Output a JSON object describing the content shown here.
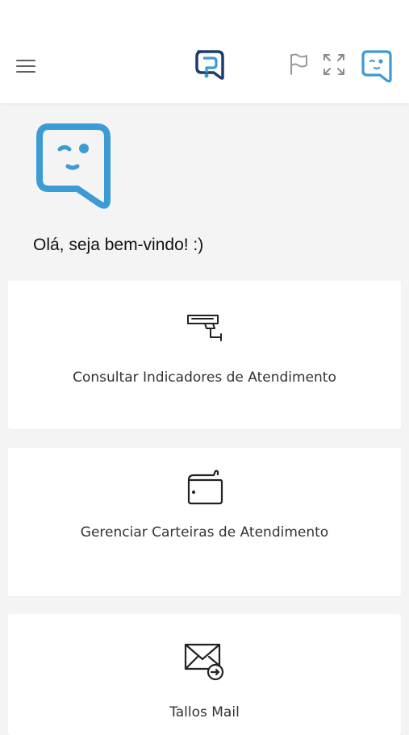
{
  "header": {
    "menu_icon": "hamburger-menu-icon",
    "logo_icon": "app-logo-icon",
    "flag_icon": "flag-icon",
    "expand_icon": "expand-fullscreen-icon",
    "avatar_icon": "assistant-face-icon",
    "accent_color": "#3b9bd4",
    "logo_color": "#1c3d6e"
  },
  "welcome": {
    "avatar_icon": "assistant-face-icon",
    "greeting": "Olá, seja bem-vindo! :)"
  },
  "cards": [
    {
      "icon": "surveillance-camera-icon",
      "label": "Consultar Indicadores de Atendimento"
    },
    {
      "icon": "wallet-icon",
      "label": "Gerenciar Carteiras de Atendimento"
    },
    {
      "icon": "mail-forward-icon",
      "label": "Tallos Mail"
    }
  ]
}
